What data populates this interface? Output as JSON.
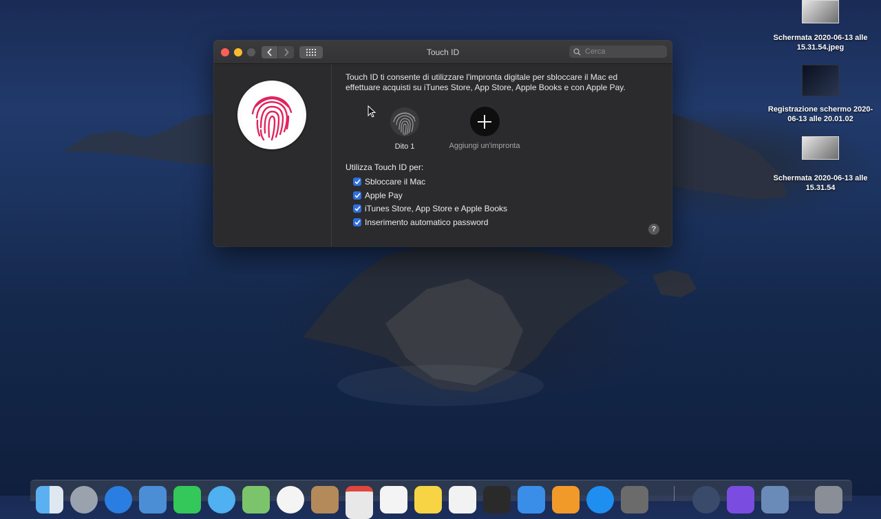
{
  "desktop": {
    "icons": [
      {
        "label": "Schermata 2020-06-13 alle 15.31.54.jpeg"
      },
      {
        "label": "Registrazione schermo 2020-06-13 alle 20.01.02"
      },
      {
        "label": "Schermata 2020-06-13 alle 15.31.54"
      }
    ]
  },
  "window": {
    "title": "Touch ID",
    "search_placeholder": "Cerca",
    "intro": "Touch ID ti consente di utilizzare l'impronta digitale per sbloccare il Mac ed effettuare acquisti su iTunes Store, App Store, Apple Books e con Apple Pay.",
    "fingerprints": [
      {
        "label": "Dito 1"
      }
    ],
    "add_fingerprint_label": "Aggiungi un'impronta",
    "use_title": "Utilizza Touch ID per:",
    "options": [
      {
        "label": "Sbloccare il Mac",
        "checked": true
      },
      {
        "label": "Apple Pay",
        "checked": true
      },
      {
        "label": "iTunes Store, App Store e Apple Books",
        "checked": true
      },
      {
        "label": "Inserimento automatico password",
        "checked": true
      }
    ],
    "help_label": "?"
  },
  "colors": {
    "accent": "#2f6fde",
    "fingerprint": "#e0245e",
    "close": "#fc5f57",
    "minimize": "#fdbc2e"
  }
}
